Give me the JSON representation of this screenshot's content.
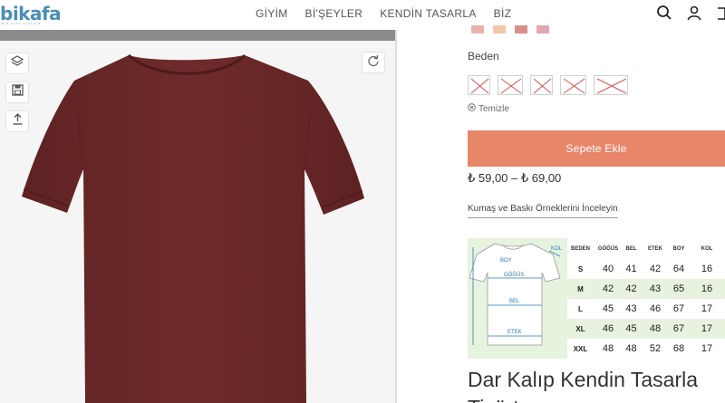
{
  "header": {
    "logo": "bikafa",
    "logo_tagline": "BİR KAFA TASARIM",
    "nav": [
      "GİYİM",
      "Bİ'ŞEYLER",
      "KENDİN TASARLA",
      "BİZ"
    ]
  },
  "designer": {
    "tools": [
      "layers-icon",
      "save-icon",
      "upload-icon"
    ],
    "shirt_color": "#6b2a2a"
  },
  "product": {
    "size_label": "Beden",
    "clear_label": "Temizle",
    "add_to_cart": "Sepete Ekle",
    "price": "₺ 59,00 – ₺ 69,00",
    "fabric_link": "Kumaş ve Baskı Örneklerini İnceleyin",
    "title_line1": "Dar Kalıp Kendin Tasarla",
    "title_line2": "Tişört"
  },
  "size_chart": {
    "diagram_labels": [
      "BOY",
      "GÖĞÜS",
      "BEL",
      "ETEK",
      "KOL"
    ],
    "headers": [
      "BEDEN",
      "GÖĞÜS",
      "BEL",
      "ETEK",
      "BOY",
      "KOL"
    ],
    "rows": [
      [
        "S",
        "40",
        "41",
        "42",
        "64",
        "16"
      ],
      [
        "M",
        "42",
        "42",
        "43",
        "65",
        "16"
      ],
      [
        "L",
        "45",
        "43",
        "46",
        "67",
        "17"
      ],
      [
        "XL",
        "46",
        "45",
        "48",
        "67",
        "17"
      ],
      [
        "XXL",
        "48",
        "48",
        "52",
        "68",
        "17"
      ]
    ]
  },
  "colors": {
    "accent": "#e8866a",
    "logo": "#4a8db5",
    "chart_green": "#e7f2df"
  }
}
